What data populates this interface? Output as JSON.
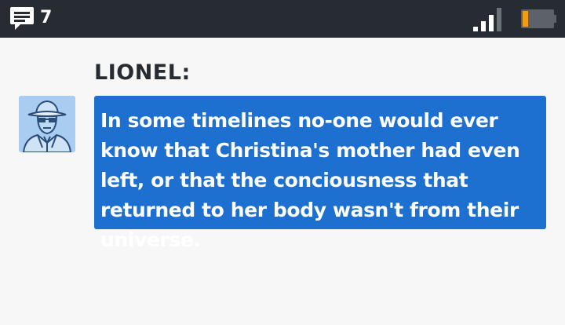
{
  "status_bar": {
    "notification_icon": "message-icon",
    "notification_count": "7",
    "signal_icon": "signal-strength-icon",
    "battery_icon": "battery-low-icon",
    "battery_color": "#f39c12"
  },
  "dialogue": {
    "speaker": "LIONEL:",
    "avatar_icon": "character-portrait-icon",
    "text": "In some timelines no-one would ever know that Christina's mother had even left, or that the conciousness that returned to her body wasn't from their universe."
  },
  "colors": {
    "status_bar_bg": "#262c31",
    "page_bg": "#f7f7f7",
    "bubble_bg": "#1d6fd0",
    "avatar_bg": "#a9cdf0"
  }
}
